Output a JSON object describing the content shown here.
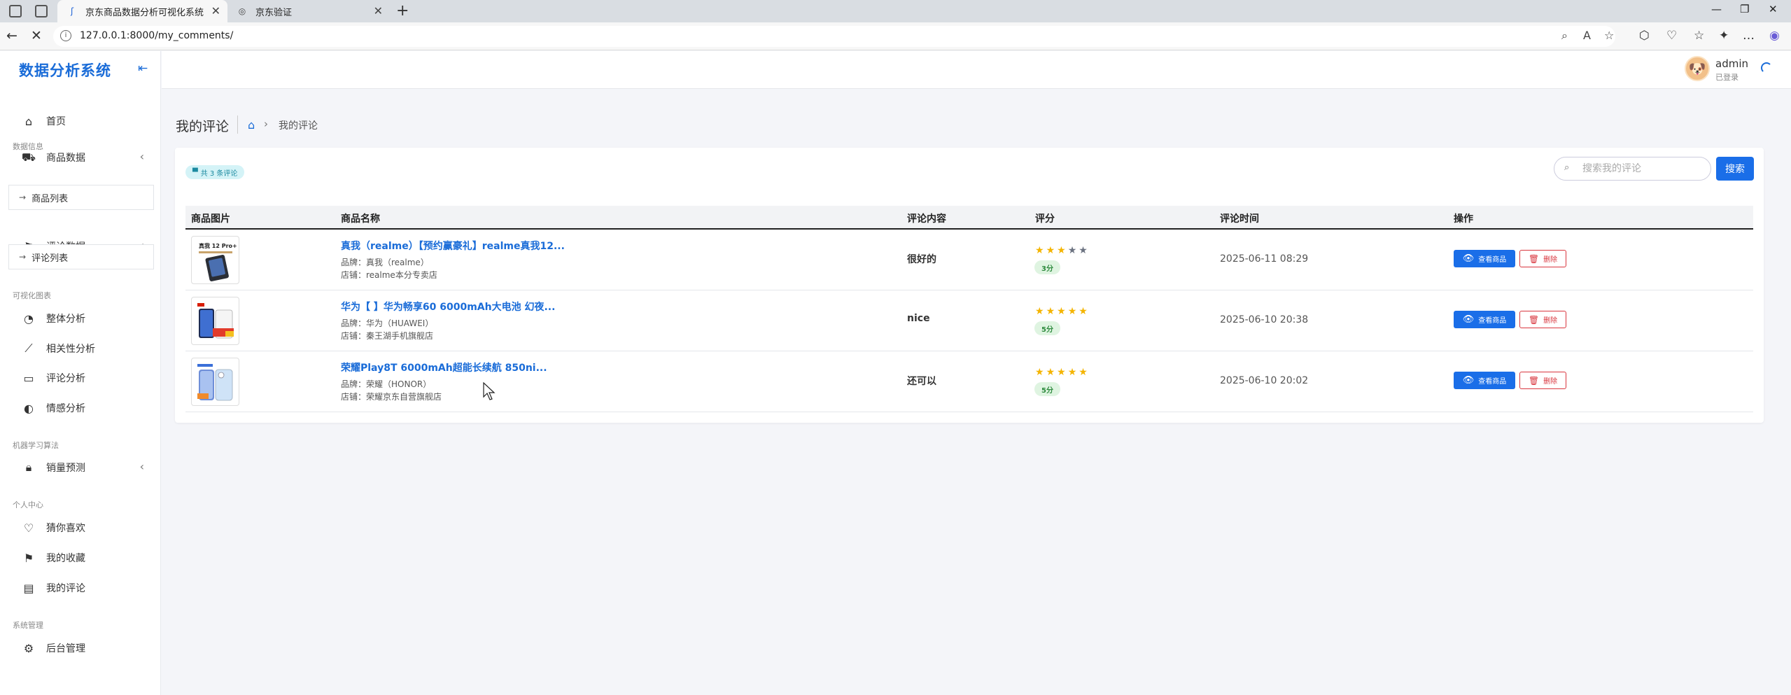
{
  "browser": {
    "tabs": [
      {
        "title": "京东商品数据分析可视化系统",
        "active": true
      },
      {
        "title": "京东验证",
        "active": false
      }
    ],
    "url": "127.0.0.1:8000/my_comments/"
  },
  "app": {
    "brand": "数据分析系统",
    "user": {
      "name": "admin",
      "status": "已登录"
    }
  },
  "sidebar": {
    "sections": [
      "数据信息",
      "可视化图表",
      "机器学习算法",
      "个人中心",
      "系统管理"
    ],
    "items": {
      "home": "首页",
      "product_data": "商品数据",
      "product_list": "商品列表",
      "comment_data": "评论数据",
      "comment_list": "评论列表",
      "overall": "整体分析",
      "correlation": "相关性分析",
      "comment_analysis": "评论分析",
      "sentiment": "情感分析",
      "sales_forecast": "销量预测",
      "guess": "猜你喜欢",
      "favorites": "我的收藏",
      "my_comments": "我的评论",
      "admin": "后台管理"
    }
  },
  "page": {
    "title": "我的评论",
    "breadcrumb_current": "我的评论",
    "count_label": "共 3 条评论",
    "search_placeholder": "搜索我的评论",
    "search_button": "搜索"
  },
  "table": {
    "columns": [
      "商品图片",
      "商品名称",
      "评论内容",
      "评分",
      "评论时间",
      "操作"
    ],
    "view_label": "查看商品",
    "delete_label": "删除",
    "rows": [
      {
        "name": "真我（realme）【预约赢豪礼】realme真我12...",
        "brand": "品牌：真我（realme）",
        "shop": "店铺：realme本分专卖店",
        "content": "很好的",
        "rating": 3,
        "score": "3分",
        "time": "2025-06-11 08:29",
        "thumb_text": "真我 12 Pro+"
      },
      {
        "name": "华为【 】华为畅享60 6000mAh大电池 幻夜...",
        "brand": "品牌：华为（HUAWEI）",
        "shop": "店铺：秦王湖手机旗舰店",
        "content": "nice",
        "rating": 5,
        "score": "5分",
        "time": "2025-06-10 20:38",
        "thumb_text": ""
      },
      {
        "name": "荣耀Play8T 6000mAh超能长续航 850ni...",
        "brand": "品牌：荣耀（HONOR）",
        "shop": "店铺：荣耀京东自营旗舰店",
        "content": "还可以",
        "rating": 5,
        "score": "5分",
        "time": "2025-06-10 20:02",
        "thumb_text": ""
      }
    ]
  },
  "colors": {
    "accent": "#1a6cd8",
    "primary_button": "#1a6ee8",
    "danger": "#d9363e",
    "star": "#f4b400"
  }
}
